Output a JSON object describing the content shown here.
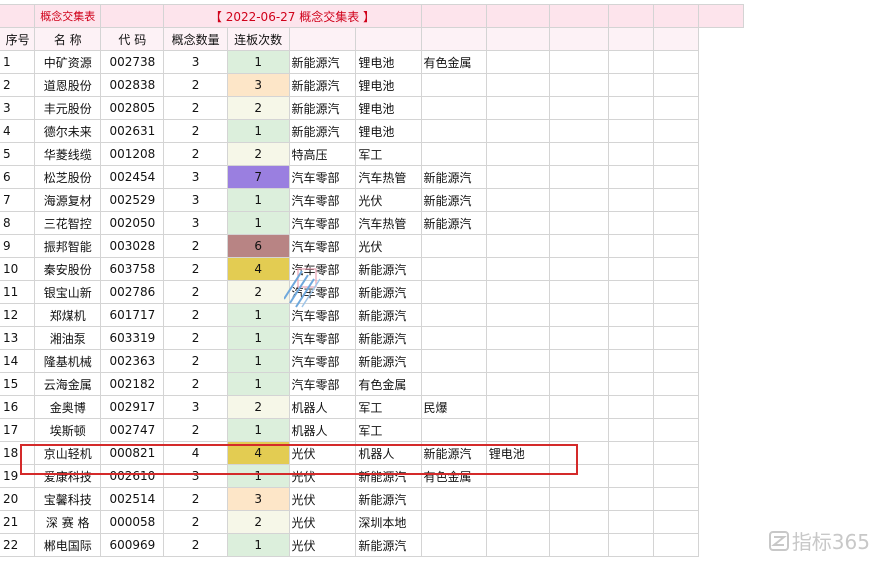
{
  "sheet": {
    "tab_label": "概念交集表",
    "title": "【 2022-06-27 概念交集表 】",
    "headers": [
      "序号",
      "名 称",
      "代 码",
      "概念数量",
      "连板次数"
    ],
    "rows": [
      {
        "idx": "1",
        "name": "中矿资源",
        "code": "002738",
        "count": "3",
        "lb": "1",
        "c1": "新能源汽",
        "c2": "锂电池",
        "c3": "有色金属",
        "c4": ""
      },
      {
        "idx": "2",
        "name": "道恩股份",
        "code": "002838",
        "count": "2",
        "lb": "3",
        "c1": "新能源汽",
        "c2": "锂电池",
        "c3": "",
        "c4": ""
      },
      {
        "idx": "3",
        "name": "丰元股份",
        "code": "002805",
        "count": "2",
        "lb": "2",
        "c1": "新能源汽",
        "c2": "锂电池",
        "c3": "",
        "c4": ""
      },
      {
        "idx": "4",
        "name": "德尔未来",
        "code": "002631",
        "count": "2",
        "lb": "1",
        "c1": "新能源汽",
        "c2": "锂电池",
        "c3": "",
        "c4": ""
      },
      {
        "idx": "5",
        "name": "华菱线缆",
        "code": "001208",
        "count": "2",
        "lb": "2",
        "c1": "特高压",
        "c2": "军工",
        "c3": "",
        "c4": ""
      },
      {
        "idx": "6",
        "name": "松芝股份",
        "code": "002454",
        "count": "3",
        "lb": "7",
        "c1": "汽车零部",
        "c2": "汽车热管",
        "c3": "新能源汽",
        "c4": ""
      },
      {
        "idx": "7",
        "name": "海源复材",
        "code": "002529",
        "count": "3",
        "lb": "1",
        "c1": "汽车零部",
        "c2": "光伏",
        "c3": "新能源汽",
        "c4": ""
      },
      {
        "idx": "8",
        "name": "三花智控",
        "code": "002050",
        "count": "3",
        "lb": "1",
        "c1": "汽车零部",
        "c2": "汽车热管",
        "c3": "新能源汽",
        "c4": ""
      },
      {
        "idx": "9",
        "name": "振邦智能",
        "code": "003028",
        "count": "2",
        "lb": "6",
        "c1": "汽车零部",
        "c2": "光伏",
        "c3": "",
        "c4": ""
      },
      {
        "idx": "10",
        "name": "秦安股份",
        "code": "603758",
        "count": "2",
        "lb": "4",
        "c1": "汽车零部",
        "c2": "新能源汽",
        "c3": "",
        "c4": ""
      },
      {
        "idx": "11",
        "name": "银宝山新",
        "code": "002786",
        "count": "2",
        "lb": "2",
        "c1": "汽车零部",
        "c2": "新能源汽",
        "c3": "",
        "c4": ""
      },
      {
        "idx": "12",
        "name": "郑煤机",
        "code": "601717",
        "count": "2",
        "lb": "1",
        "c1": "汽车零部",
        "c2": "新能源汽",
        "c3": "",
        "c4": ""
      },
      {
        "idx": "13",
        "name": "湘油泵",
        "code": "603319",
        "count": "2",
        "lb": "1",
        "c1": "汽车零部",
        "c2": "新能源汽",
        "c3": "",
        "c4": ""
      },
      {
        "idx": "14",
        "name": "隆基机械",
        "code": "002363",
        "count": "2",
        "lb": "1",
        "c1": "汽车零部",
        "c2": "新能源汽",
        "c3": "",
        "c4": ""
      },
      {
        "idx": "15",
        "name": "云海金属",
        "code": "002182",
        "count": "2",
        "lb": "1",
        "c1": "汽车零部",
        "c2": "有色金属",
        "c3": "",
        "c4": ""
      },
      {
        "idx": "16",
        "name": "金奥博",
        "code": "002917",
        "count": "3",
        "lb": "2",
        "c1": "机器人",
        "c2": "军工",
        "c3": "民爆",
        "c4": ""
      },
      {
        "idx": "17",
        "name": "埃斯顿",
        "code": "002747",
        "count": "2",
        "lb": "1",
        "c1": "机器人",
        "c2": "军工",
        "c3": "",
        "c4": ""
      },
      {
        "idx": "18",
        "name": "京山轻机",
        "code": "000821",
        "count": "4",
        "lb": "4",
        "c1": "光伏",
        "c2": "机器人",
        "c3": "新能源汽",
        "c4": "锂电池"
      },
      {
        "idx": "19",
        "name": "爱康科技",
        "code": "002610",
        "count": "3",
        "lb": "1",
        "c1": "光伏",
        "c2": "新能源汽",
        "c3": "有色金属",
        "c4": ""
      },
      {
        "idx": "20",
        "name": "宝馨科技",
        "code": "002514",
        "count": "2",
        "lb": "3",
        "c1": "光伏",
        "c2": "新能源汽",
        "c3": "",
        "c4": ""
      },
      {
        "idx": "21",
        "name": "深 赛 格",
        "code": "000058",
        "count": "2",
        "lb": "2",
        "c1": "光伏",
        "c2": "深圳本地",
        "c3": "",
        "c4": ""
      },
      {
        "idx": "22",
        "name": "郴电国际",
        "code": "600969",
        "count": "2",
        "lb": "1",
        "c1": "光伏",
        "c2": "新能源汽",
        "c3": "",
        "c4": ""
      }
    ]
  },
  "highlighted_row": "18",
  "watermark": "指标365",
  "colors": {
    "title_text": "#d0021b",
    "highlight_border": "#d42a2a",
    "lb_1": "#dcefdc",
    "lb_2": "#f6f7e8",
    "lb_3": "#fde6c8",
    "lb_4": "#e3cc52",
    "lb_6": "#b88484",
    "lb_7": "#9a7fe0"
  }
}
